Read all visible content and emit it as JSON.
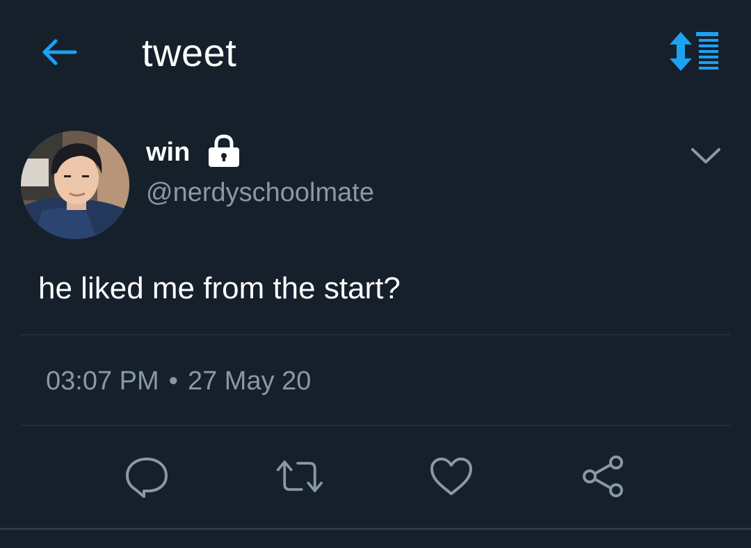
{
  "header": {
    "title": "tweet",
    "back_icon": "arrow-left-icon",
    "sort_icon": "sort-order-icon",
    "accent_color": "#1da1f2"
  },
  "tweet": {
    "author": {
      "display_name": "win",
      "username": "@nerdyschoolmate",
      "protected_icon": "lock-icon"
    },
    "text": "he liked me from the start?",
    "time": "03:07 PM",
    "separator": "•",
    "date": "27 May 20",
    "more_icon": "chevron-down-icon"
  },
  "actions": [
    {
      "name": "reply",
      "icon": "reply-icon"
    },
    {
      "name": "retweet",
      "icon": "retweet-icon"
    },
    {
      "name": "like",
      "icon": "heart-icon"
    },
    {
      "name": "share",
      "icon": "share-icon"
    }
  ],
  "colors": {
    "background": "#16202b",
    "text_primary": "#ffffff",
    "text_secondary": "#8899a6",
    "divider": "#2f3b47"
  }
}
